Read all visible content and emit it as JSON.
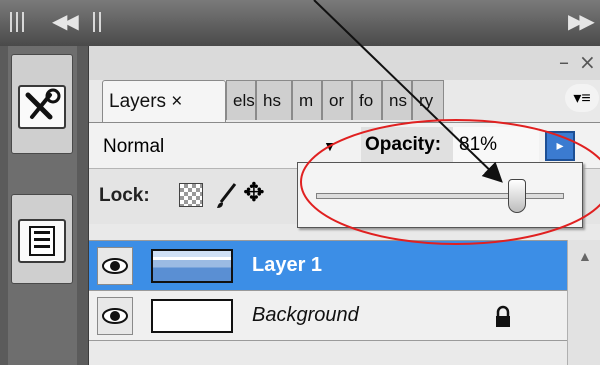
{
  "panel": {
    "tabs": [
      {
        "label": "Layers ×"
      },
      {
        "label": "els"
      },
      {
        "label": "hs"
      },
      {
        "label": "m"
      },
      {
        "label": "or"
      },
      {
        "label": "fo"
      },
      {
        "label": "ns"
      },
      {
        "label": "ry"
      }
    ],
    "window_controls": {
      "minimize": "–",
      "close": "×"
    },
    "menu_icon": "▾≡"
  },
  "blend": {
    "mode": "Normal",
    "dropdown_arrow": "▼",
    "opacity_label": "Opacity:",
    "opacity_value": "81%",
    "opacity_button": "▸"
  },
  "lock": {
    "label": "Lock:"
  },
  "slider": {
    "value": 81
  },
  "layers": [
    {
      "name": "Layer 1",
      "selected": true
    },
    {
      "name": "Background",
      "selected": false,
      "locked": true
    }
  ],
  "icons": {
    "eye": "eye-icon",
    "lock": "lock-icon",
    "transparency_lock": "checker-icon",
    "brush_lock": "brush-icon",
    "move_lock": "move-icon",
    "tools": "tools-icon",
    "info": "info-panel-icon",
    "collapse": "double-left-arrow-icon",
    "expand": "double-right-arrow-icon"
  },
  "colors": {
    "selection": "#3c8ee6",
    "annotation_ellipse": "#e02020",
    "opacity_button": "#3b7bd0"
  }
}
